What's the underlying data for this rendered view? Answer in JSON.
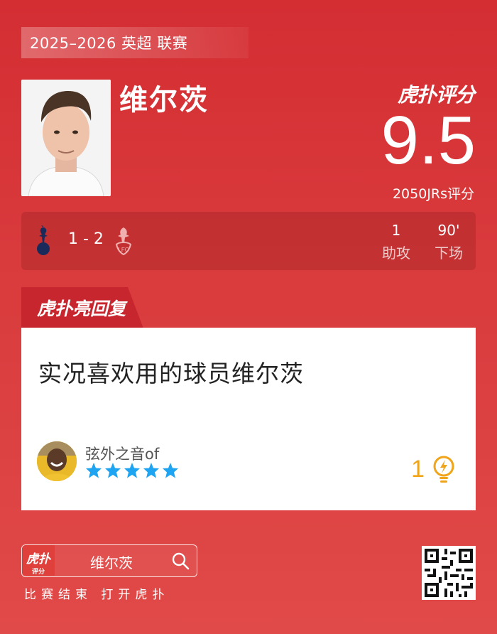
{
  "season": "2025–2026 英超 联赛",
  "player": {
    "name": "维尔茨"
  },
  "rating": {
    "brand": "虎扑评分",
    "score": "9.5",
    "count": "2050JRs评分"
  },
  "match": {
    "score": "1 - 2",
    "home_badge": "tottenham-crest-icon",
    "away_badge": "liverpool-crest-icon",
    "stats": [
      {
        "value": "1",
        "label": "助攻"
      },
      {
        "value": "90'",
        "label": "下场"
      }
    ]
  },
  "highlight": {
    "tab_label": "虎扑亮回复",
    "comment": "实况喜欢用的球员维尔茨",
    "user": {
      "name": "弦外之音of",
      "stars": 5
    },
    "likes": "1"
  },
  "footer": {
    "search_logo": "虎扑",
    "search_logo_sub": "评分",
    "search_text": "维尔茨",
    "caption": "比赛结束 打开虎扑"
  },
  "colors": {
    "background": "#d42e33",
    "accent": "#c8262e",
    "star": "#1ea4f0",
    "likes": "#f0a419"
  }
}
